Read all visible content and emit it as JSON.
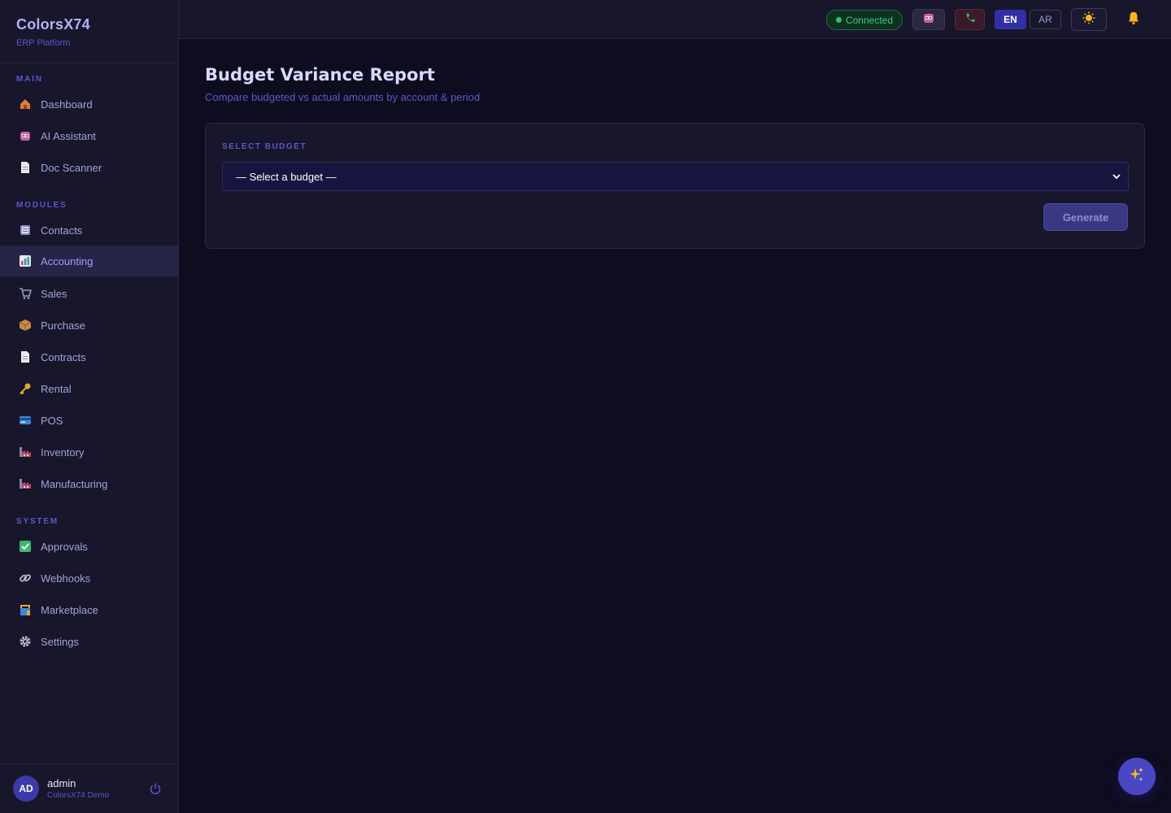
{
  "brand": {
    "title": "ColorsX74",
    "subtitle": "ERP Platform"
  },
  "sidebar": {
    "sections": [
      {
        "label": "MAIN"
      },
      {
        "label": "MODULES"
      },
      {
        "label": "SYSTEM"
      }
    ],
    "items": [
      {
        "label": "Dashboard",
        "icon": "home-icon"
      },
      {
        "label": "AI Assistant",
        "icon": "robot-icon"
      },
      {
        "label": "Doc Scanner",
        "icon": "document-icon"
      },
      {
        "label": "Contacts",
        "icon": "contacts-icon"
      },
      {
        "label": "Accounting",
        "icon": "chart-icon",
        "active": true
      },
      {
        "label": "Sales",
        "icon": "cart-icon"
      },
      {
        "label": "Purchase",
        "icon": "package-icon"
      },
      {
        "label": "Contracts",
        "icon": "document-icon"
      },
      {
        "label": "Rental",
        "icon": "key-icon"
      },
      {
        "label": "POS",
        "icon": "card-icon"
      },
      {
        "label": "Inventory",
        "icon": "factory-icon"
      },
      {
        "label": "Manufacturing",
        "icon": "factory-icon"
      },
      {
        "label": "Approvals",
        "icon": "check-icon"
      },
      {
        "label": "Webhooks",
        "icon": "link-icon"
      },
      {
        "label": "Marketplace",
        "icon": "shop-icon"
      },
      {
        "label": "Settings",
        "icon": "gear-icon"
      }
    ]
  },
  "user": {
    "initials": "AD",
    "name": "admin",
    "org": "ColorsX74 Demo"
  },
  "topbar": {
    "status": "Connected",
    "lang_en": "EN",
    "lang_ar": "AR"
  },
  "page": {
    "title": "Budget Variance Report",
    "subtitle": "Compare budgeted vs actual amounts by account & period"
  },
  "form": {
    "field_label": "SELECT BUDGET",
    "select_value": "— Select a budget —",
    "generate_label": "Generate"
  },
  "colors": {
    "background": "#0e0d1f",
    "panel": "#17162b",
    "accent": "#5b58c9",
    "active_item": "#262548",
    "connected": "#34d27a"
  }
}
